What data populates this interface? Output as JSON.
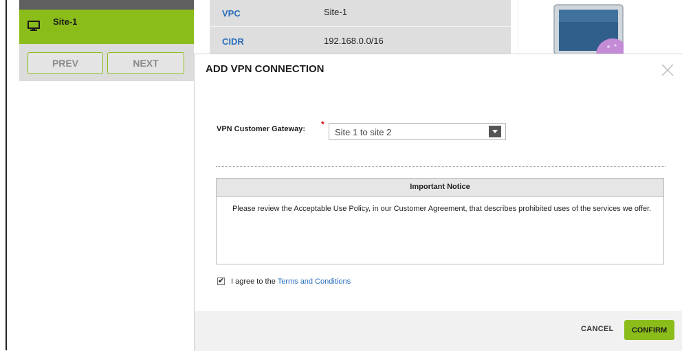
{
  "sidebar": {
    "site_label": "Site-1",
    "prev_label": "PREV",
    "next_label": "NEXT"
  },
  "vpc_details": {
    "rows": [
      {
        "key": "VPC",
        "value": "Site-1"
      },
      {
        "key": "CIDR",
        "value": "192.168.0.0/16"
      }
    ]
  },
  "modal": {
    "title": "ADD VPN CONNECTION",
    "gateway_label": "VPN Customer Gateway:",
    "required_mark": "*",
    "gateway_value": "Site 1 to site 2",
    "notice_title": "Important Notice",
    "notice_body": "Please review the Acceptable Use Policy, in our Customer Agreement, that describes prohibited uses of the services we offer.",
    "agree_prefix": "I agree to the ",
    "agree_link": "Terms and Conditions",
    "agree_checked": true,
    "cancel_label": "CANCEL",
    "confirm_label": "CONFIRM"
  },
  "colors": {
    "accent_green": "#8bbd1a",
    "link_blue": "#2a6ebb",
    "required_red": "#e00000"
  },
  "icons": [
    "desktop-icon",
    "close-icon",
    "dropdown-arrow-icon",
    "monitor-illustration"
  ]
}
